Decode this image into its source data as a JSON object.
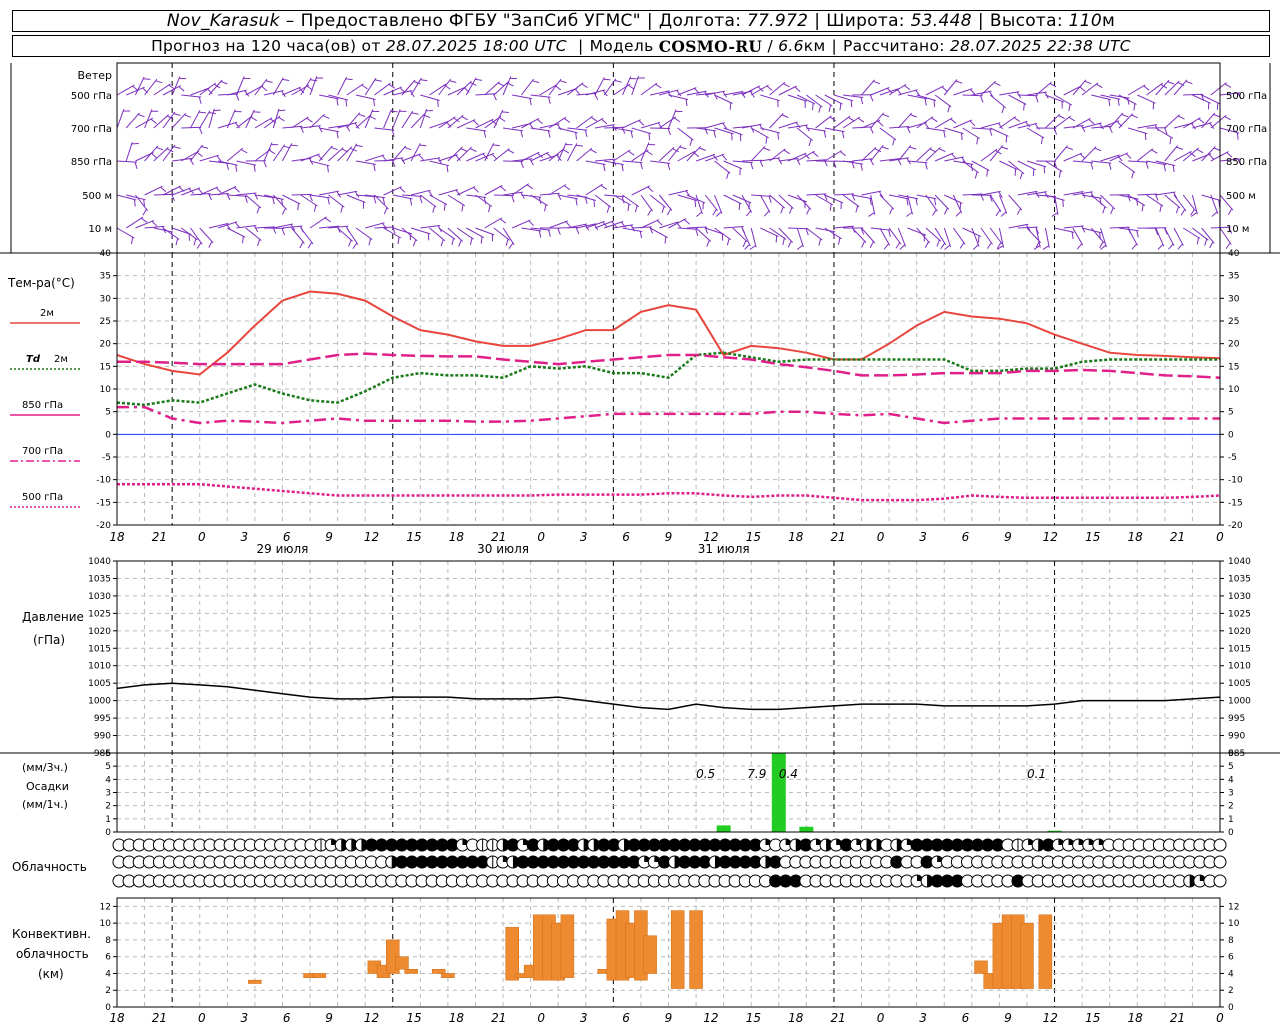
{
  "header": {
    "station": "Nov_Karasuk",
    "provider": "Предоставлено ФГБУ \"ЗапСиб УГМС\"",
    "lon_label": "Долгота:",
    "lon_value": "77.972",
    "lat_label": "Широта:",
    "lat_value": "53.448",
    "alt_label": "Высота:",
    "alt_value": "110",
    "alt_unit": "м",
    "forecast_prefix": "Прогноз на 120 часа(ов) от",
    "forecast_start": "28.07.2025 18:00 UTC",
    "model_label": "Модель",
    "model_name": "COSMO-RU",
    "model_res": "6.6",
    "model_res_unit": "км",
    "computed_label": "Рассчитано:",
    "computed_time": "28.07.2025 22:38 UTC"
  },
  "labels": {
    "wind": "Ветер",
    "wind_levels": [
      "500 гПа",
      "700 гПа",
      "850 гПа",
      "500 м",
      "10 м"
    ],
    "temp_title": "Тем-ра(°C)",
    "legend_2m": "2м",
    "legend_td": "Td",
    "legend_td2": "2м",
    "legend_850": "850 гПа",
    "legend_700": "700 гПа",
    "legend_500": "500 гПа",
    "pressure_title1": "Давление",
    "pressure_title2": "(гПа)",
    "precip_title1": "(мм/3ч.)",
    "precip_title2": "Осадки",
    "precip_title3": "(мм/1ч.)",
    "cloud_title": "Облачность",
    "conv_title1": "Конвективн.",
    "conv_title2": "облачность",
    "conv_title3": "(км)"
  },
  "chart_data": {
    "type": "meteogram",
    "x_hour_ticks": [
      "18",
      "21",
      "0",
      "3",
      "6",
      "9",
      "12",
      "15",
      "18",
      "21",
      "0",
      "3",
      "6",
      "9",
      "12",
      "15",
      "18",
      "21",
      "0",
      "3",
      "6",
      "9",
      "12",
      "15",
      "18",
      "21",
      "0"
    ],
    "day_labels": [
      "29 июля",
      "30 июля",
      "31 июля"
    ],
    "temperature": {
      "ylim": [
        -20,
        40
      ],
      "ticks": [
        -20,
        -15,
        -10,
        -5,
        0,
        5,
        10,
        15,
        20,
        25,
        30,
        35,
        40
      ],
      "series": [
        {
          "name": "2м",
          "color": "#e8453c",
          "style": "solid",
          "x": [
            0,
            3,
            6,
            9,
            12,
            15,
            18,
            21,
            24,
            27,
            30,
            33,
            36,
            39,
            42,
            45,
            48,
            51,
            54,
            57,
            60,
            63,
            66,
            69,
            72,
            75,
            78,
            81,
            84,
            87,
            90,
            93,
            96,
            99,
            102,
            105,
            108,
            111,
            114,
            117,
            120
          ],
          "y": [
            17.5,
            15.5,
            14,
            13.2,
            18,
            24,
            29.5,
            31.5,
            31,
            29.5,
            26,
            23,
            22,
            20.5,
            19.5,
            19.5,
            21,
            23,
            23,
            27,
            28.5,
            27.5,
            17.5,
            19.5,
            19,
            18,
            16.5,
            16.5,
            20,
            24,
            27,
            26,
            25.5,
            24.5,
            22,
            20,
            18,
            17.5,
            17.3,
            17,
            16.8
          ]
        },
        {
          "name": "Td 2м",
          "color": "#1a7a1a",
          "style": "dotted",
          "x": [
            0,
            3,
            6,
            9,
            12,
            15,
            18,
            21,
            24,
            27,
            30,
            33,
            36,
            39,
            42,
            45,
            48,
            51,
            54,
            57,
            60,
            63,
            66,
            69,
            72,
            75,
            78,
            81,
            84,
            87,
            90,
            93,
            96,
            99,
            102,
            105,
            108,
            111,
            114,
            117,
            120
          ],
          "y": [
            7,
            6.5,
            7.5,
            7,
            9,
            11,
            9,
            7.5,
            7,
            9.5,
            12.5,
            13.5,
            13,
            13,
            12.5,
            15,
            14.5,
            15,
            13.5,
            13.5,
            12.5,
            17.5,
            18,
            17,
            16,
            16.5,
            16.5,
            16.5,
            16.5,
            16.5,
            16.5,
            14,
            14,
            14.5,
            14.5,
            16,
            16.5,
            16.5,
            16.5,
            16.5,
            16.5
          ]
        },
        {
          "name": "850 гПа",
          "color": "#e0208a",
          "style": "dashed",
          "x": [
            0,
            3,
            6,
            9,
            12,
            15,
            18,
            21,
            24,
            27,
            30,
            33,
            36,
            39,
            42,
            45,
            48,
            51,
            54,
            57,
            60,
            63,
            66,
            69,
            72,
            75,
            78,
            81,
            84,
            87,
            90,
            93,
            96,
            99,
            102,
            105,
            108,
            111,
            114,
            117,
            120
          ],
          "y": [
            16,
            16,
            15.8,
            15.5,
            15.5,
            15.5,
            15.5,
            16.5,
            17.5,
            17.8,
            17.5,
            17.3,
            17.2,
            17.2,
            16.5,
            16,
            15.5,
            16,
            16.5,
            17,
            17.5,
            17.5,
            17,
            16.5,
            15.5,
            14.8,
            14,
            13,
            13,
            13.2,
            13.5,
            13.5,
            13.5,
            14,
            14,
            14.2,
            14,
            13.5,
            13,
            12.8,
            12.5
          ]
        },
        {
          "name": "700 гПа",
          "color": "#e0208a",
          "style": "dashdot",
          "x": [
            0,
            3,
            6,
            9,
            12,
            15,
            18,
            21,
            24,
            27,
            30,
            33,
            36,
            39,
            42,
            45,
            48,
            51,
            54,
            57,
            60,
            63,
            66,
            69,
            72,
            75,
            78,
            81,
            84,
            87,
            90,
            93,
            96,
            99,
            102,
            105,
            108,
            111,
            114,
            117,
            120
          ],
          "y": [
            6,
            6,
            3.5,
            2.5,
            3,
            2.8,
            2.5,
            3,
            3.5,
            3,
            3,
            3,
            3,
            2.8,
            2.8,
            3,
            3.5,
            4,
            4.5,
            4.5,
            4.5,
            4.5,
            4.5,
            4.5,
            5,
            5,
            4.5,
            4.2,
            4.5,
            3.5,
            2.5,
            3,
            3.5,
            3.5,
            3.5,
            3.5,
            3.5,
            3.5,
            3.5,
            3.5,
            3.5
          ]
        },
        {
          "name": "500 гПа",
          "color": "#e0208a",
          "style": "dotted",
          "x": [
            0,
            3,
            6,
            9,
            12,
            15,
            18,
            21,
            24,
            27,
            30,
            33,
            36,
            39,
            42,
            45,
            48,
            51,
            54,
            57,
            60,
            63,
            66,
            69,
            72,
            75,
            78,
            81,
            84,
            87,
            90,
            93,
            96,
            99,
            102,
            105,
            108,
            111,
            114,
            117,
            120
          ],
          "y": [
            -11,
            -11,
            -11,
            -11,
            -11.5,
            -12,
            -12.5,
            -13,
            -13.5,
            -13.5,
            -13.5,
            -13.5,
            -13.5,
            -13.5,
            -13.5,
            -13.5,
            -13.3,
            -13.3,
            -13.3,
            -13.3,
            -13,
            -13,
            -13.5,
            -13.8,
            -13.5,
            -13.5,
            -14,
            -14.5,
            -14.5,
            -14.5,
            -14.2,
            -13.5,
            -13.8,
            -14,
            -14,
            -14,
            -14,
            -14,
            -14,
            -13.8,
            -13.5
          ]
        }
      ]
    },
    "pressure": {
      "ylim": [
        985,
        1040
      ],
      "ticks": [
        985,
        990,
        995,
        1000,
        1005,
        1010,
        1015,
        1020,
        1025,
        1030,
        1035,
        1040
      ],
      "series": [
        {
          "color": "#000000",
          "x": [
            0,
            3,
            6,
            9,
            12,
            15,
            18,
            21,
            24,
            27,
            30,
            33,
            36,
            39,
            42,
            45,
            48,
            51,
            54,
            57,
            60,
            63,
            66,
            69,
            72,
            75,
            78,
            81,
            84,
            87,
            90,
            93,
            96,
            99,
            102,
            105,
            108,
            111,
            114,
            117,
            120
          ],
          "y": [
            1003.5,
            1004.5,
            1005,
            1004.5,
            1004,
            1003,
            1002,
            1001,
            1000.5,
            1000.5,
            1001,
            1001,
            1001,
            1000.5,
            1000.5,
            1000.5,
            1001,
            1000,
            999,
            998,
            997.5,
            999,
            998,
            997.5,
            997.5,
            998,
            998.5,
            999,
            999,
            999,
            998.5,
            998.5,
            998.5,
            998.5,
            999,
            1000,
            1000,
            1000,
            1000,
            1000.5,
            1001
          ]
        }
      ]
    },
    "precip": {
      "ylim": [
        0,
        6
      ],
      "ticks": [
        0,
        1,
        2,
        3,
        4,
        5,
        6
      ],
      "bars": [
        {
          "hour": 66,
          "value": 0.5
        },
        {
          "hour": 72,
          "value": 7.9
        },
        {
          "hour": 75,
          "value": 0.4
        },
        {
          "hour": 102,
          "value": 0.1
        }
      ],
      "labels": [
        "0.5",
        "7.9",
        "0.4",
        "0.1"
      ]
    },
    "convective_cloud": {
      "ylim": [
        0,
        13
      ],
      "ticks": [
        0,
        2,
        4,
        6,
        8,
        10,
        12
      ],
      "bars": [
        {
          "hour": 15,
          "bottom": 2.8,
          "top": 3.2
        },
        {
          "hour": 21,
          "bottom": 3.5,
          "top": 4
        },
        {
          "hour": 22,
          "bottom": 3.5,
          "top": 4
        },
        {
          "hour": 28,
          "bottom": 4,
          "top": 5.5
        },
        {
          "hour": 29,
          "bottom": 3.5,
          "top": 5
        },
        {
          "hour": 30,
          "bottom": 4,
          "top": 8
        },
        {
          "hour": 31,
          "bottom": 4.5,
          "top": 6
        },
        {
          "hour": 32,
          "bottom": 4,
          "top": 4.5
        },
        {
          "hour": 35,
          "bottom": 4,
          "top": 4.5
        },
        {
          "hour": 36,
          "bottom": 3.5,
          "top": 4
        },
        {
          "hour": 43,
          "bottom": 3.2,
          "top": 9.5
        },
        {
          "hour": 44,
          "bottom": 3.5,
          "top": 4
        },
        {
          "hour": 45,
          "bottom": 3.5,
          "top": 5
        },
        {
          "hour": 46,
          "bottom": 3.2,
          "top": 11
        },
        {
          "hour": 47,
          "bottom": 3.2,
          "top": 11
        },
        {
          "hour": 48,
          "bottom": 3.2,
          "top": 10
        },
        {
          "hour": 49,
          "bottom": 3.5,
          "top": 11
        },
        {
          "hour": 53,
          "bottom": 4,
          "top": 4.5
        },
        {
          "hour": 54,
          "bottom": 3.2,
          "top": 10.5
        },
        {
          "hour": 55,
          "bottom": 3.2,
          "top": 11.5
        },
        {
          "hour": 56,
          "bottom": 3.5,
          "top": 10
        },
        {
          "hour": 57,
          "bottom": 3.2,
          "top": 11.5
        },
        {
          "hour": 58,
          "bottom": 4,
          "top": 8.5
        },
        {
          "hour": 61,
          "bottom": 2.2,
          "top": 11.5
        },
        {
          "hour": 63,
          "bottom": 2.2,
          "top": 11.5
        },
        {
          "hour": 94,
          "bottom": 4,
          "top": 5.5
        },
        {
          "hour": 95,
          "bottom": 2.2,
          "top": 4
        },
        {
          "hour": 96,
          "bottom": 2.2,
          "top": 10
        },
        {
          "hour": 97,
          "bottom": 2.2,
          "top": 11
        },
        {
          "hour": 98,
          "bottom": 2.2,
          "top": 11
        },
        {
          "hour": 99,
          "bottom": 2.2,
          "top": 10
        },
        {
          "hour": 101,
          "bottom": 2.2,
          "top": 11
        }
      ]
    },
    "cloud_rows": {
      "rows": 3,
      "codes": [
        "00000000000000000000123334444444442011342434443344344444444444442023423242330324444444440123422222000000000000",
        "00000000000000000000000000034444444441234444444444442243444344443400000000000400420000000000000000000000000000",
        "00000000000000000000000000000000000000000000000000000000000000000444000000000002344400000400000000000000003200"
      ]
    },
    "grid": "on"
  }
}
